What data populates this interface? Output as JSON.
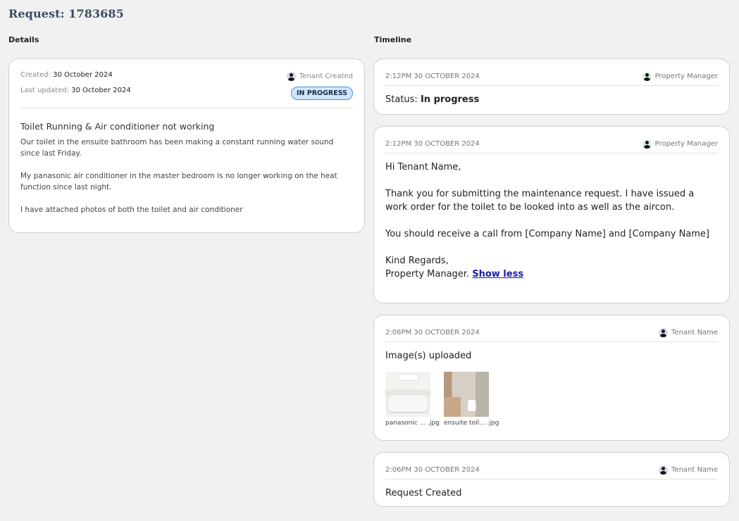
{
  "page": {
    "title": "Request: 1783685"
  },
  "sections": {
    "details": "Details",
    "timeline": "Timeline"
  },
  "details": {
    "created_label": "Created:",
    "created_value": "30 October 2024",
    "updated_label": "Last updated:",
    "updated_value": "30 October 2024",
    "creator": "Tenant Created",
    "status_badge": "IN PROGRESS",
    "title": "Toilet Running & Air conditioner not working",
    "body": [
      "Our toilet in the ensuite bathroom has been making a constant running water sound since last Friday.",
      "My panasonic air conditioner in the master bedroom is no longer working on the heat function since last night.",
      "I have attached photos of both the toilet and air conditioner"
    ]
  },
  "timeline": [
    {
      "time": "2:12PM 30 OCTOBER 2024",
      "author": "Property Manager",
      "status_label": "Status:",
      "status_value": "In progress"
    },
    {
      "time": "2:12PM 30 OCTOBER 2024",
      "author": "Property Manager",
      "greeting": "Hi Tenant Name,",
      "p1": "Thank you for submitting the maintenance request. I have issued a work order for the toilet to be looked into as well as the aircon.",
      "p2": "You should receive a call from [Company Name] and [Company Name]",
      "closing": "Kind Regards,",
      "signature": "Property Manager.",
      "toggle": "Show less"
    },
    {
      "time": "2:06PM 30 OCTOBER 2024",
      "author": "Tenant Name",
      "text": "Image(s) uploaded",
      "images": [
        {
          "caption": "panasonic ... .jpg"
        },
        {
          "caption": "ensuite toil... .jpg"
        }
      ]
    },
    {
      "time": "2:06PM 30 OCTOBER 2024",
      "author": "Tenant Name",
      "text": "Request Created"
    }
  ]
}
